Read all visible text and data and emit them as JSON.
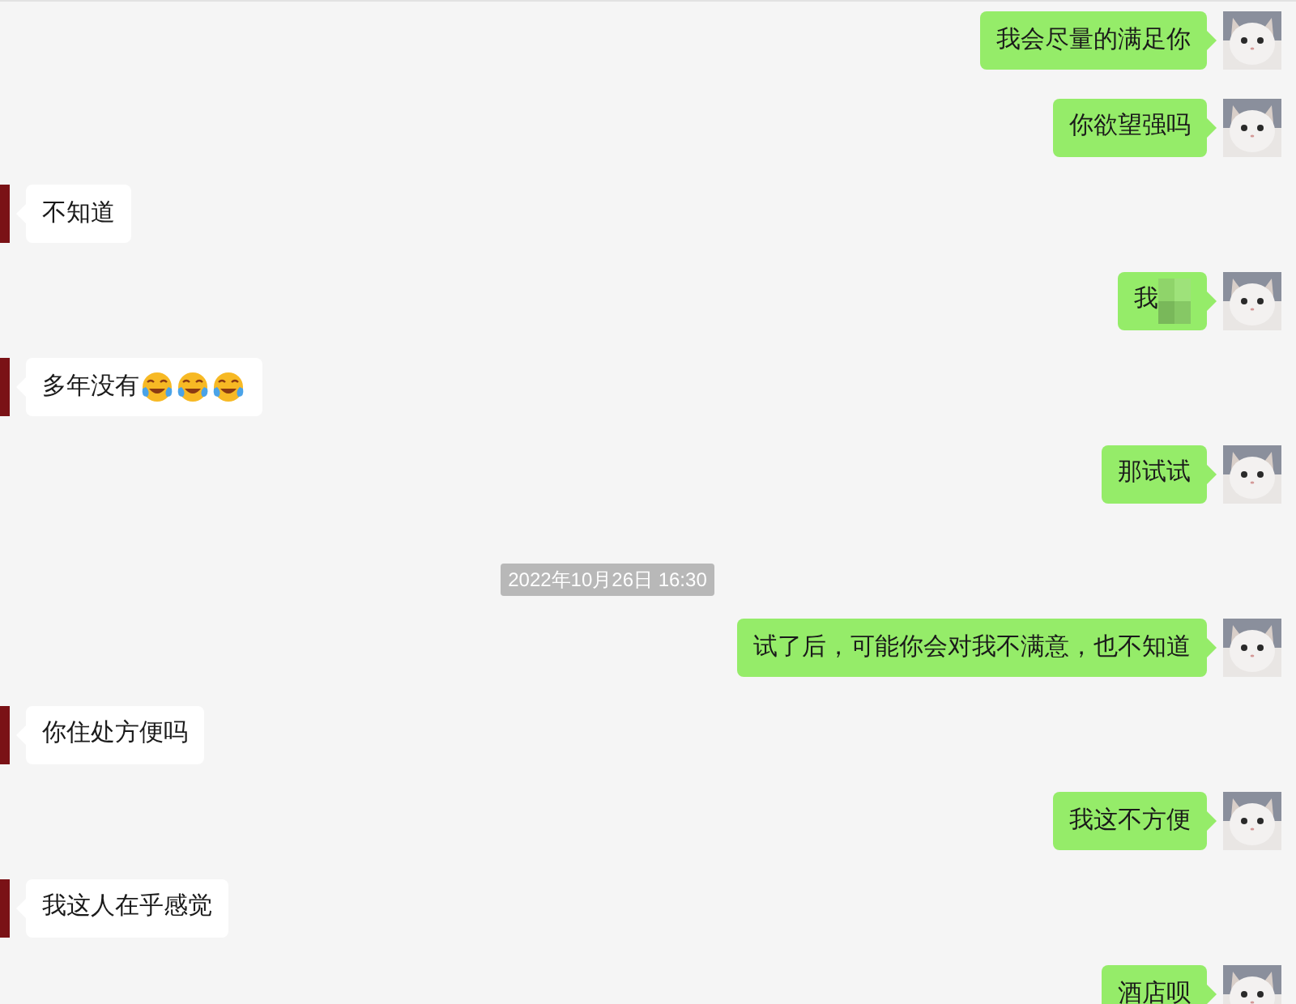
{
  "messages": [
    {
      "kind": "sent",
      "text": "我会尽量的满足你"
    },
    {
      "kind": "sent",
      "text": "你欲望强吗"
    },
    {
      "kind": "received",
      "text": "不知道"
    },
    {
      "kind": "sent",
      "text": "我",
      "redacted": true
    },
    {
      "kind": "received",
      "text": "多年没有",
      "emojis": [
        {
          "kind": "tears-of-joy"
        },
        {
          "kind": "tears-of-joy"
        },
        {
          "kind": "tears-of-joy"
        }
      ]
    },
    {
      "kind": "sent",
      "text": "那试试"
    },
    {
      "kind": "time",
      "text": "2022年10月26日 16:30"
    },
    {
      "kind": "sent",
      "text": "试了后，可能你会对我不满意，也不知道"
    },
    {
      "kind": "received",
      "text": "你住处方便吗"
    },
    {
      "kind": "sent",
      "text": "我这不方便"
    },
    {
      "kind": "received",
      "text": "我这人在乎感觉"
    },
    {
      "kind": "sent",
      "text": "酒店呗"
    }
  ]
}
